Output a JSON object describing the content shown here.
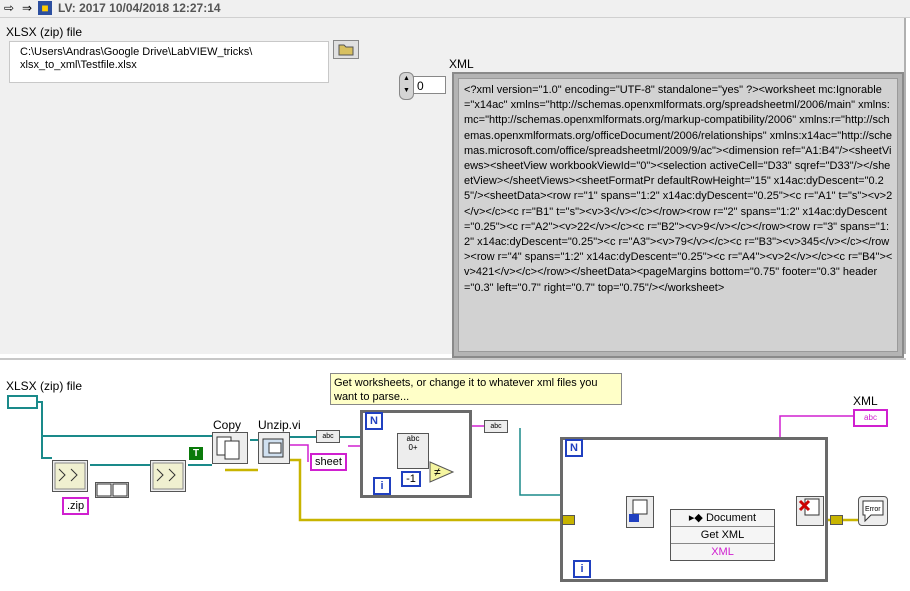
{
  "window": {
    "title": "LV: 2017 10/04/2018 12:27:14"
  },
  "front_panel": {
    "path_control": {
      "label": "XLSX (zip) file",
      "value": "C:\\Users\\Andras\\Google Drive\\LabVIEW_tricks\\\nxlsx_to_xml\\Testfile.xlsx"
    },
    "index": {
      "value": "0"
    },
    "xml_indicator": {
      "label": "XML",
      "value": "<?xml version=\"1.0\" encoding=\"UTF-8\" standalone=\"yes\" ?><worksheet mc:Ignorable=\"x14ac\" xmlns=\"http://schemas.openxmlformats.org/spreadsheetml/2006/main\" xmlns:mc=\"http://schemas.openxmlformats.org/markup-compatibility/2006\" xmlns:r=\"http://schemas.openxmlformats.org/officeDocument/2006/relationships\" xmlns:x14ac=\"http://schemas.microsoft.com/office/spreadsheetml/2009/9/ac\"><dimension ref=\"A1:B4\"/><sheetViews><sheetView workbookViewId=\"0\"><selection activeCell=\"D33\" sqref=\"D33\"/></sheetView></sheetViews><sheetFormatPr defaultRowHeight=\"15\" x14ac:dyDescent=\"0.25\"/><sheetData><row r=\"1\" spans=\"1:2\" x14ac:dyDescent=\"0.25\"><c r=\"A1\" t=\"s\"><v>2</v></c><c r=\"B1\" t=\"s\"><v>3</v></c></row><row r=\"2\" spans=\"1:2\" x14ac:dyDescent=\"0.25\"><c r=\"A2\"><v>22</v></c><c r=\"B2\"><v>9</v></c></row><row r=\"3\" spans=\"1:2\" x14ac:dyDescent=\"0.25\"><c r=\"A3\"><v>79</v></c><c r=\"B3\"><v>345</v></c></row><row r=\"4\" spans=\"1:2\" x14ac:dyDescent=\"0.25\"><c r=\"A4\"><v>2</v></c><c r=\"B4\"><v>421</v></c></row></sheetData><pageMargins bottom=\"0.75\" footer=\"0.3\" header=\"0.3\" left=\"0.7\" right=\"0.7\" top=\"0.75\"/></worksheet>"
    }
  },
  "block_diagram": {
    "path_terminal_label": "XLSX (zip) file",
    "xml_terminal_label": "XML",
    "comment": "Get worksheets, or change it to whatever xml files you want to parse...",
    "copy_label": "Copy",
    "unzip_label": "Unzip.vi",
    "zip_constant": ".zip",
    "sheet_constant": "sheet",
    "true_constant": "T",
    "neg_one_constant": "-1",
    "loop_count_label": "N",
    "loop_iter_label": "i",
    "xml_indicator_text": "abc",
    "property_node": {
      "class": "Document",
      "property": "Get XML",
      "output": "XML"
    }
  },
  "colors": {
    "string_wire": "#d020d0",
    "path_wire": "#1a8a8a",
    "error_wire": "#c8b400",
    "refnum_wire": "#1a8a8a",
    "loop_border": "#6a6a6a"
  }
}
